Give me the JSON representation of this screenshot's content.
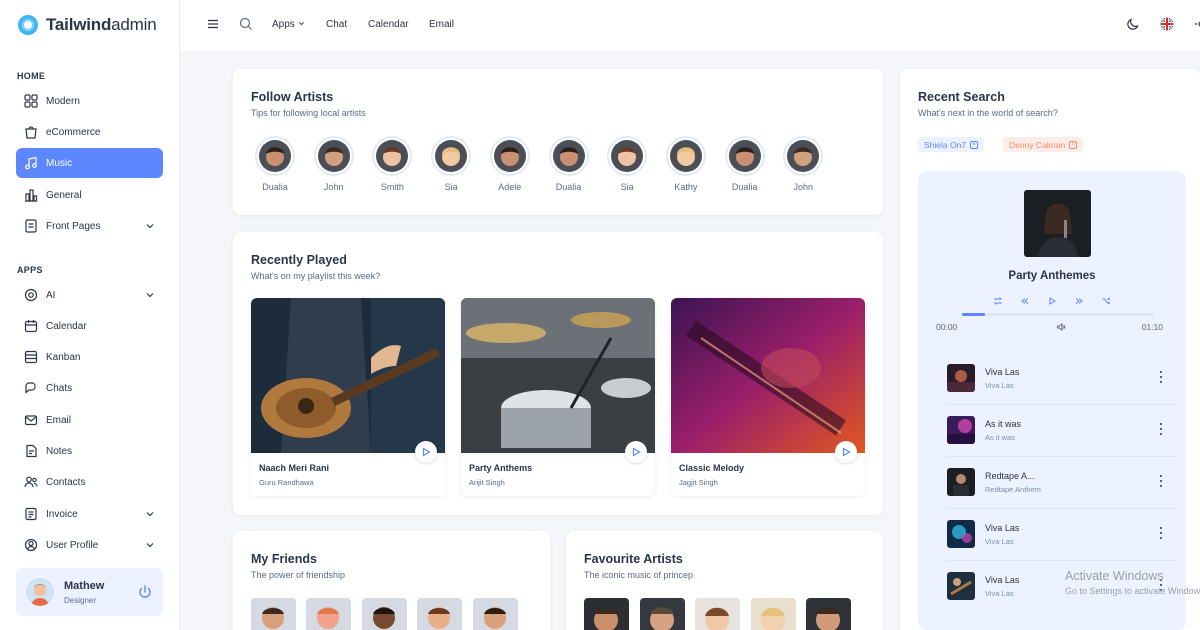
{
  "brand": {
    "name_bold": "Tailwind",
    "name_light": "admin"
  },
  "topbar": {
    "links": [
      "Apps",
      "Chat",
      "Calendar",
      "Email"
    ]
  },
  "sidebar": {
    "home_caption": "HOME",
    "home_items": [
      {
        "label": "Modern",
        "icon": "grid-icon"
      },
      {
        "label": "eCommerce",
        "icon": "shopping-bag-icon"
      },
      {
        "label": "Music",
        "icon": "music-note-icon",
        "active": true
      },
      {
        "label": "General",
        "icon": "bar-chart-icon"
      },
      {
        "label": "Front Pages",
        "icon": "document-icon",
        "expandable": true
      }
    ],
    "apps_caption": "APPS",
    "apps_items": [
      {
        "label": "AI",
        "icon": "ai-icon",
        "expandable": true
      },
      {
        "label": "Calendar",
        "icon": "calendar-icon"
      },
      {
        "label": "Kanban",
        "icon": "kanban-icon"
      },
      {
        "label": "Chats",
        "icon": "chat-icon"
      },
      {
        "label": "Email",
        "icon": "mail-icon"
      },
      {
        "label": "Notes",
        "icon": "note-icon"
      },
      {
        "label": "Contacts",
        "icon": "contacts-icon"
      },
      {
        "label": "Invoice",
        "icon": "invoice-icon",
        "expandable": true
      },
      {
        "label": "User Profile",
        "icon": "user-icon",
        "expandable": true
      }
    ],
    "profile": {
      "name": "Mathew",
      "role": "Designer"
    }
  },
  "follow_artists": {
    "title": "Follow Artists",
    "subtitle": "Tips for following local artists",
    "artists": [
      "Dualia",
      "John",
      "Smith",
      "Sia",
      "Adele",
      "Dualia",
      "Sia",
      "Kathy",
      "Dualia",
      "John"
    ]
  },
  "recently_played": {
    "title": "Recently Played",
    "subtitle": "What's on my playlist this week?",
    "items": [
      {
        "title": "Naach Meri Rani",
        "artist": "Guru Randhawa"
      },
      {
        "title": "Party Anthems",
        "artist": "Arijit Singh"
      },
      {
        "title": "Classic Melody",
        "artist": "Jagjit Singh"
      }
    ]
  },
  "my_friends": {
    "title": "My Friends",
    "subtitle": "The power of friendship"
  },
  "favourite_artists": {
    "title": "Favourite Artists",
    "subtitle": "The iconic music of princep"
  },
  "recent_search": {
    "title": "Recent Search",
    "subtitle": "What's next in the world of search?",
    "chips": [
      "Shiela On7",
      "Denny Caknan"
    ]
  },
  "player": {
    "now_playing": "Party Anthemes",
    "time_current": "00:00",
    "time_total": "01:10",
    "progress": 0.12,
    "tracks": [
      {
        "title": "Viva Las",
        "artist": "Viva Las"
      },
      {
        "title": "As it was",
        "artist": "As it was"
      },
      {
        "title": "Redtape A...",
        "artist": "Redtape Anthem"
      },
      {
        "title": "Viva Las",
        "artist": "Viva Las"
      },
      {
        "title": "Viva Las",
        "artist": "Viva Las"
      }
    ]
  },
  "watermark": {
    "line1": "Activate Windows",
    "line2": "Go to Settings to activate Windows."
  },
  "colors": {
    "primary": "#5d87ff",
    "primary_light": "#ecf2ff",
    "chip_red": "#fa896b",
    "text": "#2a3547"
  }
}
